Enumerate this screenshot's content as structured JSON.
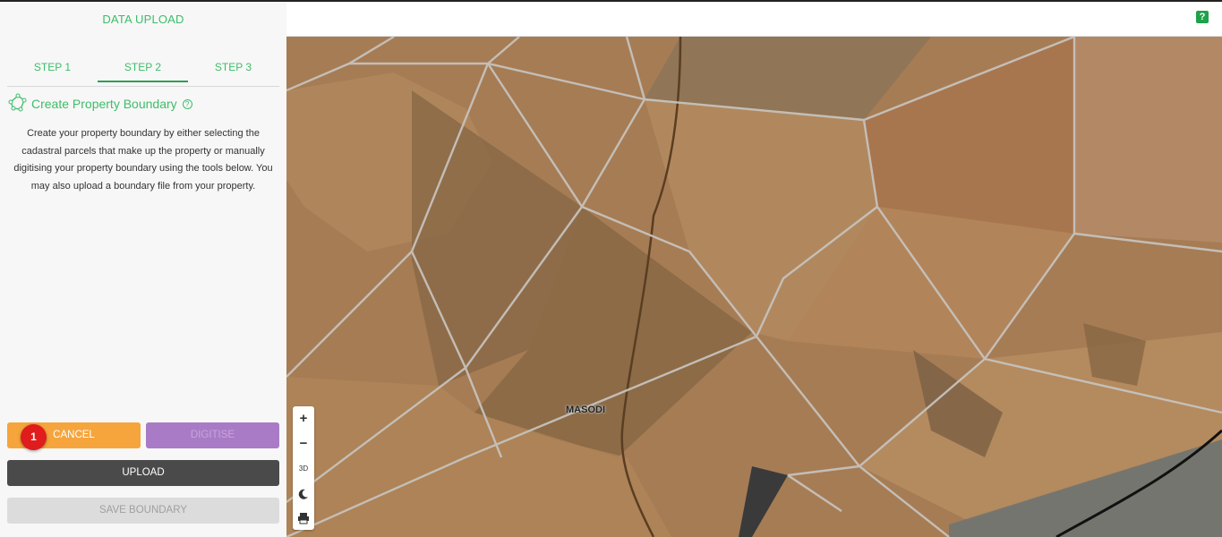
{
  "panel": {
    "title": "DATA UPLOAD",
    "tabs": [
      {
        "label": "STEP 1"
      },
      {
        "label": "STEP 2",
        "active": true
      },
      {
        "label": "STEP 3"
      }
    ],
    "section_title": "Create Property Boundary",
    "description": "Create your property boundary by either selecting the cadastral parcels that make up the property or manually digitising your property boundary using the tools below. You may also upload a boundary file from your property.",
    "buttons": {
      "cancel": "CANCEL",
      "digitise": "DIGITISE",
      "upload": "UPLOAD",
      "save": "SAVE BOUNDARY"
    },
    "step_badge": "1"
  },
  "topbar": {
    "help_label": "?"
  },
  "map": {
    "place_label": "MASODI",
    "controls": {
      "zoom_in": "+",
      "zoom_out": "−",
      "three_d": "3D"
    },
    "colors": {
      "terrain": "#a67c55",
      "parcel_line": "#c9c9c9",
      "accent": "#3dbd6a"
    }
  }
}
